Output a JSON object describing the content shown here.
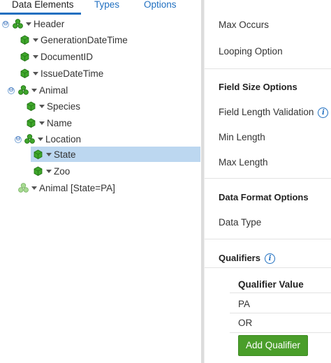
{
  "tabs": [
    {
      "label": "Data Elements"
    },
    {
      "label": "Types"
    },
    {
      "label": "Options"
    }
  ],
  "tree": [
    {
      "label": "Header",
      "toggle": "⊖"
    },
    {
      "label": "GenerationDateTime"
    },
    {
      "label": "DocumentID"
    },
    {
      "label": "IssueDateTime"
    },
    {
      "label": "Animal",
      "toggle": "⊖"
    },
    {
      "label": "Species"
    },
    {
      "label": "Name"
    },
    {
      "label": "Location",
      "toggle": "⊖"
    },
    {
      "label": "State",
      "selected": true
    },
    {
      "label": "Zoo"
    },
    {
      "label": "Animal [State=PA]"
    }
  ],
  "props": {
    "max_occurs": "Max Occurs",
    "looping_option": "Looping Option",
    "field_size_section": "Field Size Options",
    "field_length_validation": "Field Length Validation",
    "min_length": "Min Length",
    "max_length": "Max Length",
    "data_format_section": "Data Format Options",
    "data_type": "Data Type",
    "qualifiers_section": "Qualifiers",
    "info_glyph": "i",
    "qualifier_header": "Qualifier Value",
    "qualifier_values": [
      "PA",
      "OR"
    ],
    "add_qualifier": "Add Qualifier"
  },
  "colors": {
    "accent": "#1f6fc0",
    "selection": "#bcd7f0",
    "button": "#4a9e2a",
    "icon_green": "#3fa62b"
  }
}
